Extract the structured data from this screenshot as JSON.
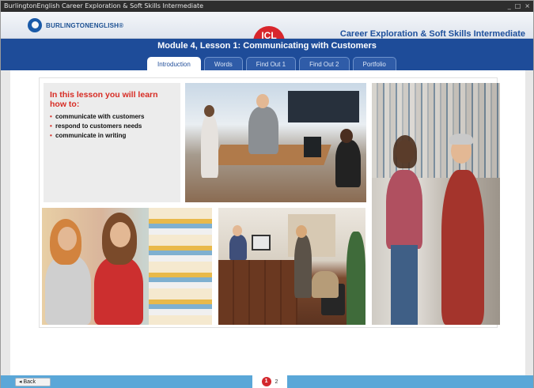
{
  "window": {
    "title": "BurlingtonEnglish Career Exploration & Soft Skills Intermediate",
    "controls": [
      "_",
      "□",
      "×"
    ]
  },
  "header": {
    "logo_text": "BURLINGTONENGLISH®",
    "badge": "ICL",
    "course_title": "Career Exploration & Soft Skills Intermediate"
  },
  "lesson": {
    "title": "Module 4, Lesson 1: Communicating with Customers",
    "tabs": [
      {
        "label": "Introduction",
        "active": true
      },
      {
        "label": "Words",
        "active": false
      },
      {
        "label": "Find Out 1",
        "active": false
      },
      {
        "label": "Find Out 2",
        "active": false
      },
      {
        "label": "Portfolio",
        "active": false
      }
    ]
  },
  "intro": {
    "heading": "In this lesson you will learn how to:",
    "items": [
      "communicate with customers",
      "respond to customers needs",
      "communicate in writing"
    ]
  },
  "footer": {
    "back_label": "Back",
    "current_page": "1",
    "next_page": "2"
  },
  "colors": {
    "brand_blue": "#1e4c99",
    "accent_red": "#d72c24",
    "footer_blue": "#5aa7d8"
  }
}
